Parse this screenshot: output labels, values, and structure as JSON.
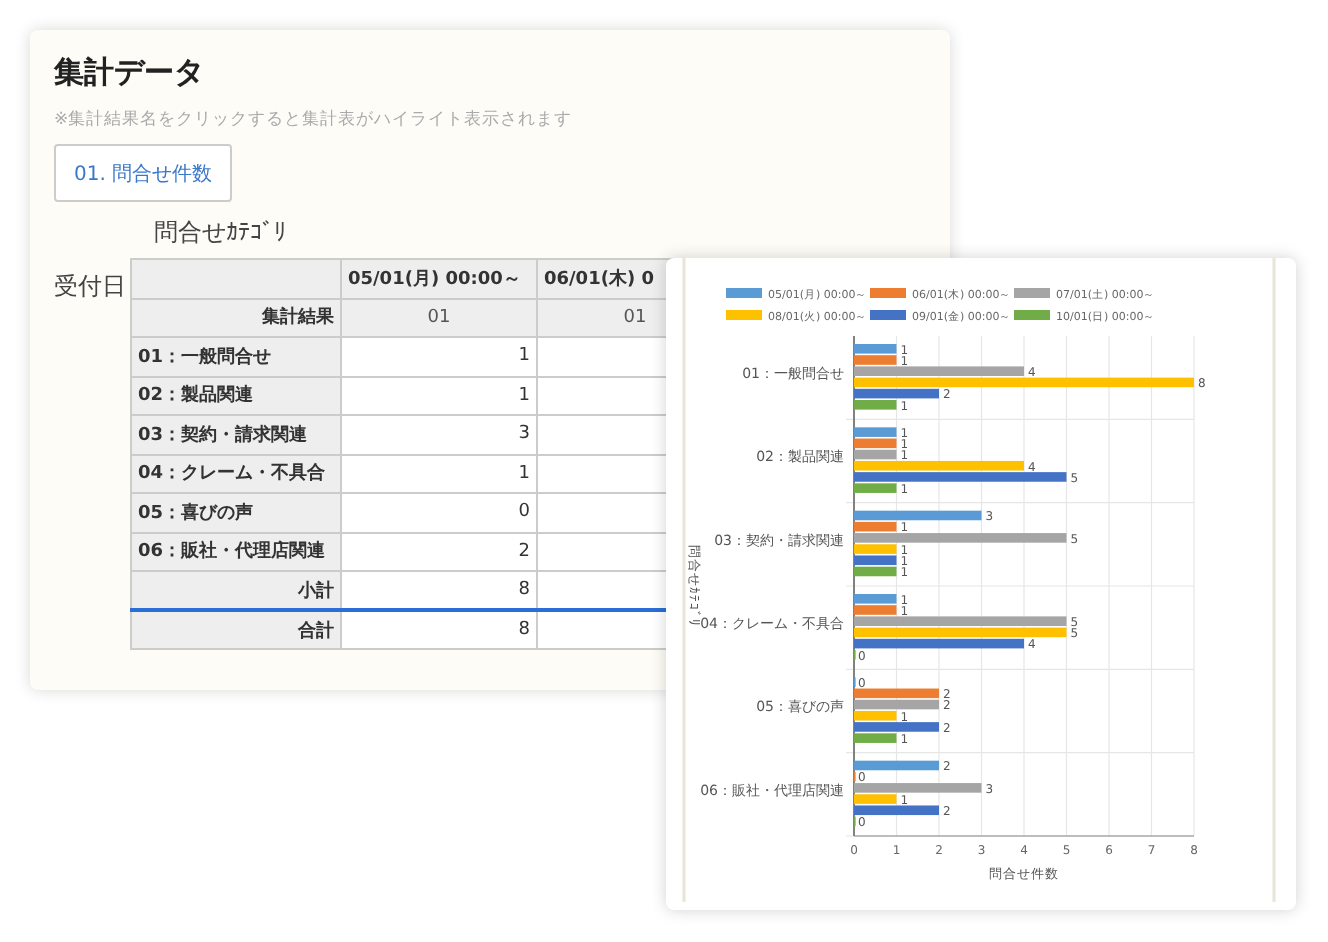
{
  "title": "集計データ",
  "note": "※集計結果名をクリックすると集計表がハイライト表示されます",
  "result_button": {
    "label": "01. 問合せ件数"
  },
  "table": {
    "column_axis_label": "問合せｶﾃｺﾞﾘ",
    "row_axis_label": "受付日",
    "columns": [
      "05/01(月) 00:00～",
      "06/01(木) 0"
    ],
    "subheader_label": "集計結果",
    "subheader": [
      "01",
      "01"
    ],
    "rows": [
      {
        "label": "01：一般問合せ",
        "values": [
          "1"
        ]
      },
      {
        "label": "02：製品関連",
        "values": [
          "1"
        ]
      },
      {
        "label": "03：契約・請求関連",
        "values": [
          "3"
        ]
      },
      {
        "label": "04：クレーム・不具合",
        "values": [
          "1"
        ]
      },
      {
        "label": "05：喜びの声",
        "values": [
          "0"
        ]
      },
      {
        "label": "06：販社・代理店関連",
        "values": [
          "2"
        ]
      }
    ],
    "subtotal": {
      "label": "小計",
      "values": [
        "8"
      ]
    },
    "total": {
      "label": "合計",
      "values": [
        "8"
      ]
    }
  },
  "chart": {
    "chart_data": {
      "type": "bar",
      "orientation": "horizontal",
      "xlabel": "問合せ件数",
      "ylabel": "問合せｶﾃｺﾞﾘ",
      "categories": [
        "01：一般問合せ",
        "02：製品関連",
        "03：契約・請求関連",
        "04：クレーム・不具合",
        "05：喜びの声",
        "06：販社・代理店関連"
      ],
      "series": [
        {
          "name": "05/01(月) 00:00～",
          "color": "#5b9bd5",
          "values": [
            1,
            1,
            3,
            1,
            0,
            2
          ],
          "value_labels": [
            "1",
            "1",
            "3",
            "1",
            "0",
            "2"
          ]
        },
        {
          "name": "06/01(木) 00:00～",
          "color": "#ed7d31",
          "values": [
            1,
            1,
            1,
            1,
            2,
            0
          ],
          "value_labels": [
            "1",
            "1",
            "1",
            "1",
            "2",
            "0"
          ]
        },
        {
          "name": "07/01(土) 00:00～",
          "color": "#a5a5a5",
          "values": [
            4,
            1,
            5,
            5,
            2,
            3
          ],
          "value_labels": [
            "4",
            "1",
            "5",
            "5",
            "2",
            "3"
          ]
        },
        {
          "name": "08/01(火) 00:00～",
          "color": "#ffc000",
          "values": [
            8,
            4,
            1,
            5,
            1,
            1
          ],
          "value_labels": [
            "8",
            "4",
            "1",
            "5",
            "1",
            "1"
          ]
        },
        {
          "name": "09/01(金) 00:00～",
          "color": "#4472c4",
          "values": [
            2,
            5,
            1,
            4,
            2,
            2
          ],
          "value_labels": [
            "2",
            "5",
            "1",
            "4",
            "2",
            "2"
          ]
        },
        {
          "name": "10/01(日) 00:00～",
          "color": "#70ad47",
          "values": [
            1,
            1,
            1,
            0,
            1,
            0
          ],
          "value_labels": [
            "1",
            "1",
            "1",
            "0",
            "1",
            "0"
          ]
        }
      ],
      "grid": true,
      "legend": true,
      "xlim": [
        0,
        8
      ],
      "xticks": [
        0,
        1,
        2,
        3,
        4,
        5,
        6,
        7,
        8
      ],
      "data_labels": true
    }
  }
}
